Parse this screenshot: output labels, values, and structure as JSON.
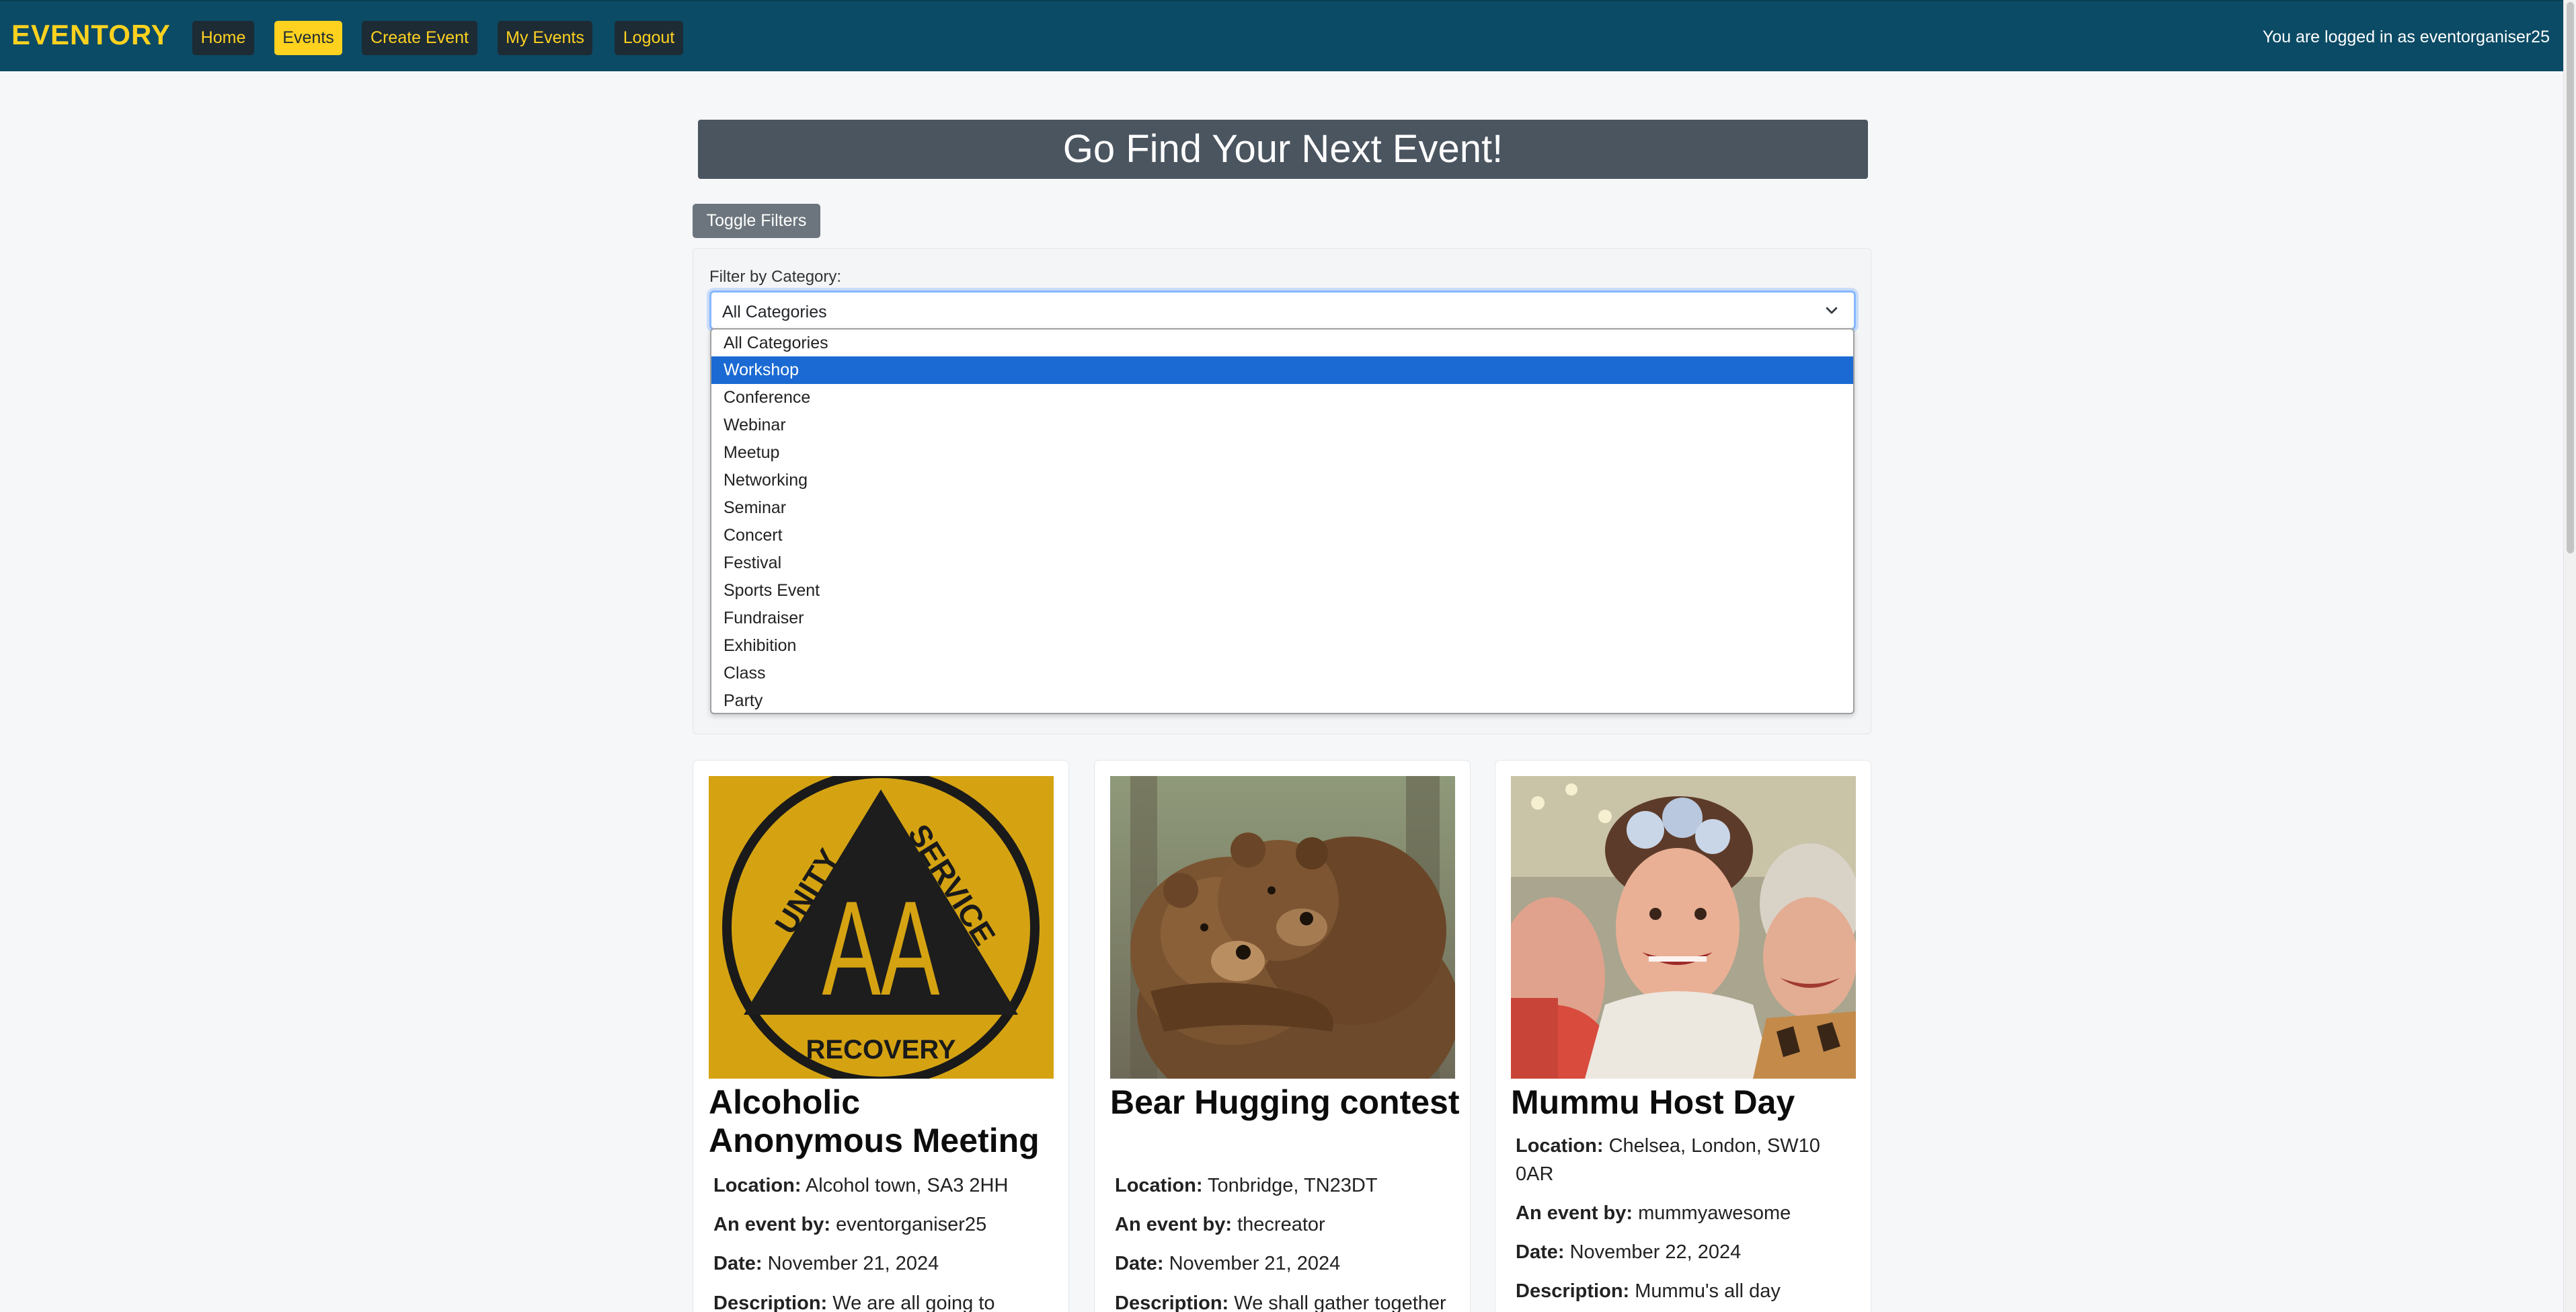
{
  "nav": {
    "brand": "EVENTORY",
    "items": [
      {
        "label": "Home",
        "active": false
      },
      {
        "label": "Events",
        "active": true
      },
      {
        "label": "Create Event",
        "active": false
      },
      {
        "label": "My Events",
        "active": false
      },
      {
        "label": "Logout",
        "active": false
      }
    ],
    "login_status": "You are logged in as eventorganiser25"
  },
  "header": {
    "title": "Go Find Your Next Event!",
    "toggle_filters_label": "Toggle Filters"
  },
  "filter": {
    "label": "Filter by Category:",
    "selected_value": "All Categories",
    "highlighted_option": "Workshop",
    "options": [
      "All Categories",
      "Workshop",
      "Conference",
      "Webinar",
      "Meetup",
      "Networking",
      "Seminar",
      "Concert",
      "Festival",
      "Sports Event",
      "Fundraiser",
      "Exhibition",
      "Class",
      "Party"
    ]
  },
  "labels": {
    "location": "Location:",
    "organiser": "An event by:",
    "date": "Date:",
    "description": "Description:"
  },
  "events": [
    {
      "title": "Alcoholic Anonymous Meeting",
      "location": "Alcohol town, SA3 2HH",
      "organiser": "eventorganiser25",
      "date": "November 21, 2024",
      "description": "We are all going to",
      "image": {
        "type": "aa-logo",
        "top_text": "UNITY",
        "right_text": "SERVICE",
        "center_text": "AA",
        "bottom_text": "RECOVERY"
      }
    },
    {
      "title": "Bear Hugging contest",
      "location": "Tonbridge, TN23DT",
      "organiser": "thecreator",
      "date": "November 21, 2024",
      "description": "We shall gather together to see who can do the ...",
      "image": {
        "type": "bears-photo"
      }
    },
    {
      "title": "Mummu Host Day",
      "location": "Chelsea, London, SW10 0AR",
      "organiser": "mummyawesome",
      "date": "November 22, 2024",
      "description": "Mummu's all day",
      "image": {
        "type": "party-photo"
      }
    }
  ],
  "colors": {
    "navbar": "#0b4b65",
    "accent": "#ffd21f",
    "title_bar": "#4a5560",
    "highlight": "#1b6ad3"
  }
}
